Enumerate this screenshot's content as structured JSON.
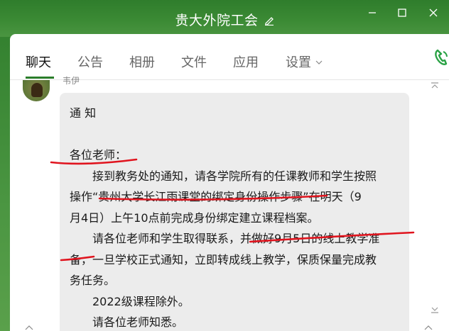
{
  "window": {
    "title": "贵大外院工会"
  },
  "tabs": [
    {
      "label": "聊天",
      "active": true
    },
    {
      "label": "公告",
      "active": false
    },
    {
      "label": "相册",
      "active": false
    },
    {
      "label": "文件",
      "active": false
    },
    {
      "label": "应用",
      "active": false
    },
    {
      "label": "设置",
      "active": false
    }
  ],
  "message": {
    "sender": "韦伊",
    "lines": [
      "通  知",
      "",
      "各位老师：",
      "接到教务处的通知，请各学院所有的任课教师和学生按照",
      "操作“贵州大学长江雨课堂的绑定身份操作步骤”在明天（9",
      "月4日）上午10点前完成身份绑定建立课程档案。",
      "请各位老师和学生取得联系，并做好9月5日的线上教学准",
      "备，一旦学校正式通知，立即转成线上教学，保质保量完成教",
      "务任务。",
      "2022级课程除外。",
      "请各位老师知悉。"
    ]
  },
  "colors": {
    "brand_green": "#3b8a34",
    "tab_active_underline": "#2a7d2a",
    "bubble": "#ececec",
    "annotation_red": "#e0141e"
  },
  "icons": {
    "title_edit": "pencil-icon",
    "call": "phone-icon",
    "settings_dropdown": "chevron-down-icon"
  }
}
